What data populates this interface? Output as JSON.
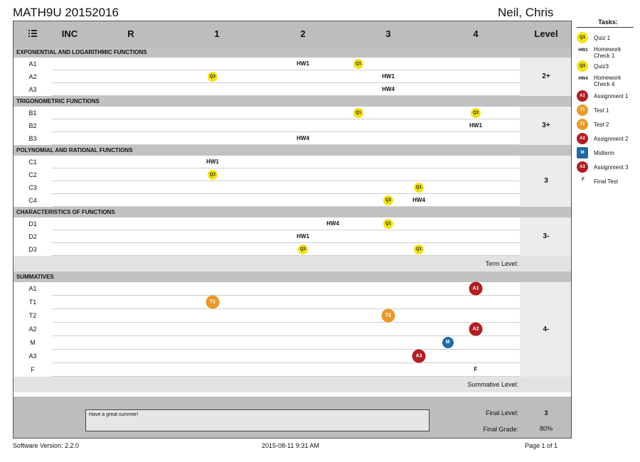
{
  "header": {
    "course": "MATH9U  20152016",
    "student": "Neil, Chris"
  },
  "columns": {
    "inc": "INC",
    "r": "R",
    "c1": "1",
    "c2": "2",
    "c3": "3",
    "c4": "4",
    "level": "Level"
  },
  "sections": [
    {
      "title": "EXPONENTIAL AND LOGARITHMIC FUNCTIONS",
      "level": "2+",
      "rows": [
        {
          "label": "A1",
          "marks": [
            {
              "type": "hw",
              "text": "HW1",
              "at": 2.0
            },
            {
              "type": "q",
              "text": "Q1",
              "at": 2.65
            }
          ]
        },
        {
          "label": "A2",
          "marks": [
            {
              "type": "q",
              "text": "Q3",
              "at": 0.95
            },
            {
              "type": "hw",
              "text": "HW1",
              "at": 3.0
            }
          ]
        },
        {
          "label": "A3",
          "marks": [
            {
              "type": "hw",
              "text": "HW4",
              "at": 3.0
            }
          ]
        }
      ]
    },
    {
      "title": "TRIGONOMETRIC FUNCTIONS",
      "level": "3+",
      "rows": [
        {
          "label": "B1",
          "marks": [
            {
              "type": "q",
              "text": "Q1",
              "at": 2.65
            },
            {
              "type": "q",
              "text": "Q3",
              "at": 4.0
            }
          ]
        },
        {
          "label": "B2",
          "marks": [
            {
              "type": "hw",
              "text": "HW1",
              "at": 4.0
            }
          ]
        },
        {
          "label": "B3",
          "marks": [
            {
              "type": "hw",
              "text": "HW4",
              "at": 2.0
            }
          ]
        }
      ]
    },
    {
      "title": "POLYNOMIAL AND RATIONAL FUNCTIONS",
      "level": "3",
      "rows": [
        {
          "label": "C1",
          "marks": [
            {
              "type": "hw",
              "text": "HW1",
              "at": 0.95
            }
          ]
        },
        {
          "label": "C2",
          "marks": [
            {
              "type": "q",
              "text": "Q3",
              "at": 0.95
            }
          ]
        },
        {
          "label": "C3",
          "marks": [
            {
              "type": "q",
              "text": "Q1",
              "at": 3.35
            }
          ]
        },
        {
          "label": "C4",
          "marks": [
            {
              "type": "q",
              "text": "Q3",
              "at": 3.0
            },
            {
              "type": "hw",
              "text": "HW4",
              "at": 3.35
            }
          ]
        }
      ]
    },
    {
      "title": "CHARACTERISTICS OF FUNCTIONS",
      "level": "3-",
      "rows": [
        {
          "label": "D1",
          "marks": [
            {
              "type": "hw",
              "text": "HW4",
              "at": 2.35
            },
            {
              "type": "q",
              "text": "Q1",
              "at": 3.0
            }
          ]
        },
        {
          "label": "D2",
          "marks": [
            {
              "type": "hw",
              "text": "HW1",
              "at": 2.0
            }
          ]
        },
        {
          "label": "D3",
          "marks": [
            {
              "type": "q",
              "text": "Q3",
              "at": 2.0
            },
            {
              "type": "q",
              "text": "Q1",
              "at": 3.35
            }
          ]
        }
      ]
    }
  ],
  "term_level_label": "Term Level:",
  "summatives": {
    "title": "SUMMATIVES",
    "level": "4-",
    "rows": [
      {
        "label": "A1",
        "marks": [
          {
            "type": "a",
            "text": "A1",
            "at": 4.35
          }
        ]
      },
      {
        "label": "T1",
        "marks": [
          {
            "type": "t",
            "text": "T1",
            "at": 0.95
          }
        ]
      },
      {
        "label": "T2",
        "marks": [
          {
            "type": "t",
            "text": "T2",
            "at": 3.0
          }
        ]
      },
      {
        "label": "A2",
        "marks": [
          {
            "type": "a",
            "text": "A2",
            "at": 4.0
          }
        ]
      },
      {
        "label": "M",
        "marks": [
          {
            "type": "m",
            "text": "M",
            "at": 3.68
          }
        ]
      },
      {
        "label": "A3",
        "marks": [
          {
            "type": "a",
            "text": "A3",
            "at": 3.35
          }
        ]
      },
      {
        "label": "F",
        "marks": [
          {
            "type": "f",
            "text": "F",
            "at": 4.0
          }
        ]
      }
    ]
  },
  "summative_level_label": "Summative Level:",
  "footer": {
    "comment": "Have a great summer!",
    "final_level_label": "Final Level:",
    "final_level": "3",
    "final_grade_label": "Final Grade:",
    "final_grade": "80%"
  },
  "page_footer": {
    "version": "Software Version: 2.2.0",
    "timestamp": "2015-08-11 9:31 AM",
    "page": "Page 1 of 1"
  },
  "tasks": {
    "title": "Tasks:",
    "items": [
      {
        "type": "q",
        "code": "Q1",
        "label": "Quiz 1"
      },
      {
        "type": "hw",
        "code": "HW1",
        "label": "Homework Check 1"
      },
      {
        "type": "q",
        "code": "Q3",
        "label": "Quiz3"
      },
      {
        "type": "hw",
        "code": "HW4",
        "label": "Homework Check 4"
      },
      {
        "type": "a",
        "code": "A1",
        "label": "Assignment 1"
      },
      {
        "type": "t",
        "code": "T1",
        "label": "Test 1"
      },
      {
        "type": "t",
        "code": "T2",
        "label": "Test 2"
      },
      {
        "type": "a",
        "code": "A2",
        "label": "Assignment 2"
      },
      {
        "type": "m",
        "code": "M",
        "label": "Midterm"
      },
      {
        "type": "a",
        "code": "A3",
        "label": "Assignment 3"
      },
      {
        "type": "f",
        "code": "F",
        "label": "Final Test"
      }
    ]
  },
  "colors": {
    "quiz": "#f2e21c",
    "assignment": "#b01e23",
    "test": "#e89a2c",
    "midterm": "#1f6aa5"
  }
}
